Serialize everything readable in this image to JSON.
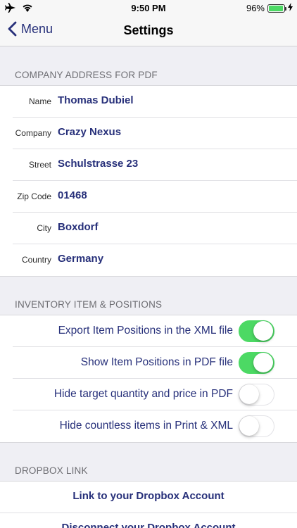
{
  "status_bar": {
    "time": "9:50 PM",
    "battery_percent": "96%",
    "battery_level": 0.96,
    "icons": [
      "airplane-icon",
      "wifi-icon",
      "battery-icon",
      "charging-bolt-icon"
    ]
  },
  "nav": {
    "back_label": "Menu",
    "title": "Settings"
  },
  "company_section": {
    "header": "COMPANY ADDRESS FOR PDF",
    "fields": [
      {
        "label": "Name",
        "value": "Thomas Dubiel"
      },
      {
        "label": "Company",
        "value": "Crazy Nexus"
      },
      {
        "label": "Street",
        "value": "Schulstrasse 23"
      },
      {
        "label": "Zip Code",
        "value": "01468"
      },
      {
        "label": "City",
        "value": "Boxdorf"
      },
      {
        "label": "Country",
        "value": "Germany"
      }
    ]
  },
  "inventory_section": {
    "header": "INVENTORY ITEM & POSITIONS",
    "toggles": [
      {
        "label": "Export Item Positions in the XML file",
        "on": true
      },
      {
        "label": "Show Item Positions in PDF file",
        "on": true
      },
      {
        "label": "Hide target quantity and price in PDF",
        "on": false
      },
      {
        "label": "Hide countless items in Print & XML",
        "on": false
      }
    ]
  },
  "dropbox_section": {
    "header": "DROPBOX LINK",
    "links": [
      {
        "label": "Link to your Dropbox Account"
      },
      {
        "label": "Disconnect your Dropbox Account"
      }
    ]
  },
  "colors": {
    "accent": "#27307a",
    "toggle_on": "#4cd964",
    "background": "#efeff4"
  }
}
